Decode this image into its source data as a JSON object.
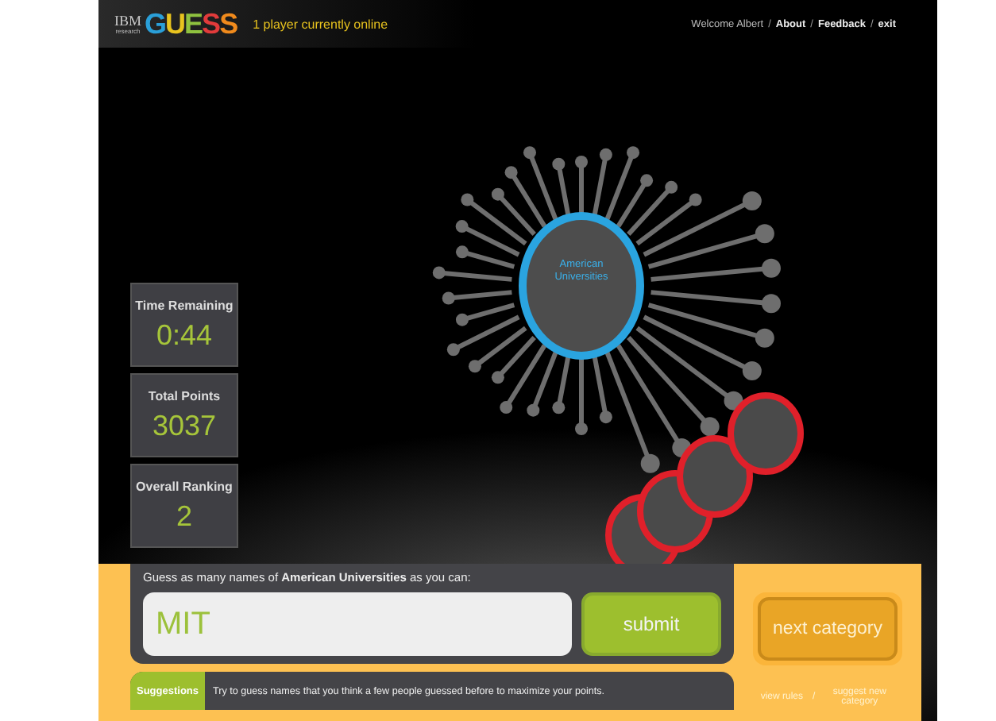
{
  "header": {
    "logo_small": "IBM",
    "logo_sub": "research",
    "logo": "GUESS",
    "online": "1 player currently online",
    "separator": "/",
    "links": [
      {
        "label": "Welcome Albert",
        "kind": "text"
      },
      {
        "label": "About",
        "kind": "link"
      },
      {
        "label": "Feedback",
        "kind": "link"
      },
      {
        "label": "exit",
        "kind": "link"
      }
    ]
  },
  "category": {
    "label": "American Universities"
  },
  "stats": [
    {
      "label": "Time Remaining",
      "value": "0:44"
    },
    {
      "label": "Total Points",
      "value": "3037"
    },
    {
      "label": "Overall Ranking",
      "value": "2"
    }
  ],
  "guess_panel": {
    "prompt": "Guess as many names of **American Universities** as you can:",
    "value": "MIT",
    "submit": "submit",
    "next": "next category"
  },
  "suggestions": {
    "label": "Suggestions",
    "text": "Try to guess names that you think a few people guessed before to maximize your points."
  },
  "footer_links": {
    "separator": "/",
    "items": [
      "view rules",
      "suggest new category"
    ]
  }
}
